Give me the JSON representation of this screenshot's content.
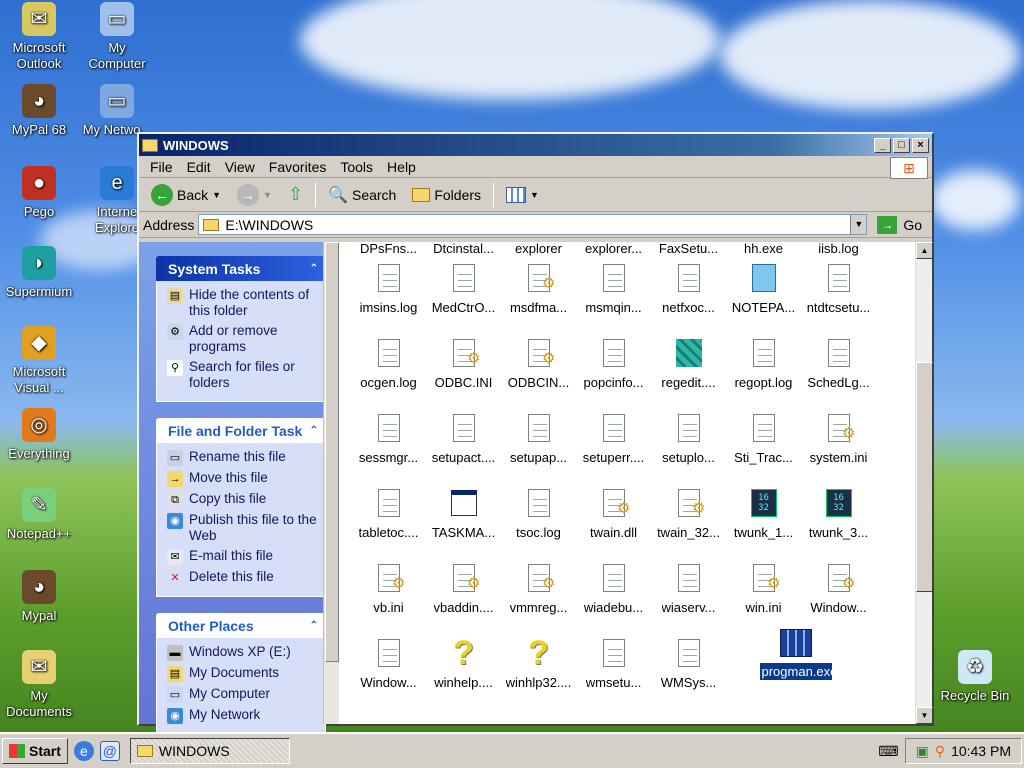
{
  "desktop": {
    "icons": [
      {
        "label": "Microsoft Outlook",
        "icon": "outlook-icon"
      },
      {
        "label": "My Computer",
        "icon": "computer-icon"
      },
      {
        "label": "MyPal 68",
        "icon": "mypal-icon"
      },
      {
        "label": "My Netwo...",
        "icon": "network-icon"
      },
      {
        "label": "Pego",
        "icon": "pego-icon"
      },
      {
        "label": "Interne Explore",
        "icon": "ie-icon"
      },
      {
        "label": "Supermium",
        "icon": "supermium-icon"
      },
      {
        "label": "Microsoft Visual ...",
        "icon": "visual-icon"
      },
      {
        "label": "Everything",
        "icon": "everything-icon"
      },
      {
        "label": "Notepad++",
        "icon": "notepadpp-icon"
      },
      {
        "label": "Mypal",
        "icon": "mypal-icon"
      },
      {
        "label": "My Documents",
        "icon": "documents-icon"
      },
      {
        "label": "Recycle Bin",
        "icon": "recycle-bin-icon"
      }
    ]
  },
  "window": {
    "title": "WINDOWS",
    "menu": [
      "File",
      "Edit",
      "View",
      "Favorites",
      "Tools",
      "Help"
    ],
    "toolbar": {
      "back": "Back",
      "search": "Search",
      "folders": "Folders"
    },
    "address": {
      "label": "Address",
      "value": "E:\\WINDOWS",
      "go": "Go"
    }
  },
  "tasks": {
    "system": {
      "title": "System Tasks",
      "items": [
        "Hide the contents of this folder",
        "Add or remove programs",
        "Search for files or folders"
      ]
    },
    "file_folder": {
      "title": "File and Folder Task",
      "items": [
        "Rename this file",
        "Move this file",
        "Copy this file",
        "Publish this file to the Web",
        "E-mail this file",
        "Delete this file"
      ]
    },
    "other": {
      "title": "Other Places",
      "items": [
        "Windows XP (E:)",
        "My Documents",
        "My Computer",
        "My Network"
      ]
    }
  },
  "files": {
    "top_partial": [
      "DPsFns...",
      "Dtcinstal...",
      "explorer",
      "explorer...",
      "FaxSetu...",
      "hh.exe",
      "iisb.log"
    ],
    "items": [
      {
        "name": "imsins.log",
        "type": "doc"
      },
      {
        "name": "MedCtrO...",
        "type": "doc"
      },
      {
        "name": "msdfma...",
        "type": "cfg"
      },
      {
        "name": "msmqin...",
        "type": "doc"
      },
      {
        "name": "netfxoc...",
        "type": "doc"
      },
      {
        "name": "NOTEPA...",
        "type": "note"
      },
      {
        "name": "ntdtcsetu...",
        "type": "doc"
      },
      {
        "name": "ocgen.log",
        "type": "doc"
      },
      {
        "name": "ODBC.INI",
        "type": "cfg"
      },
      {
        "name": "ODBCIN...",
        "type": "cfg"
      },
      {
        "name": "popcinfo...",
        "type": "doc"
      },
      {
        "name": "regedit....",
        "type": "cubes"
      },
      {
        "name": "regopt.log",
        "type": "doc"
      },
      {
        "name": "SchedLg...",
        "type": "doc"
      },
      {
        "name": "sessmgr...",
        "type": "doc"
      },
      {
        "name": "setupact....",
        "type": "doc"
      },
      {
        "name": "setupap...",
        "type": "doc"
      },
      {
        "name": "setuperr....",
        "type": "doc"
      },
      {
        "name": "setuplo...",
        "type": "doc"
      },
      {
        "name": "Sti_Trac...",
        "type": "doc"
      },
      {
        "name": "system.ini",
        "type": "cfg"
      },
      {
        "name": "tabletoc....",
        "type": "doc"
      },
      {
        "name": "TASKMA...",
        "type": "app"
      },
      {
        "name": "tsoc.log",
        "type": "doc"
      },
      {
        "name": "twain.dll",
        "type": "cfg"
      },
      {
        "name": "twain_32...",
        "type": "cfg"
      },
      {
        "name": "twunk_1...",
        "type": "blk"
      },
      {
        "name": "twunk_3...",
        "type": "blk"
      },
      {
        "name": "vb.ini",
        "type": "cfg"
      },
      {
        "name": "vbaddin....",
        "type": "cfg"
      },
      {
        "name": "vmmreg...",
        "type": "cfg"
      },
      {
        "name": "wiadebu...",
        "type": "doc"
      },
      {
        "name": "wiaserv...",
        "type": "doc"
      },
      {
        "name": "win.ini",
        "type": "cfg"
      },
      {
        "name": "Window...",
        "type": "cfg"
      },
      {
        "name": "Window...",
        "type": "doc"
      },
      {
        "name": "winhelp....",
        "type": "help"
      },
      {
        "name": "winhlp32....",
        "type": "help"
      },
      {
        "name": "wmsetu...",
        "type": "doc"
      },
      {
        "name": "WMSys...",
        "type": "doc"
      }
    ],
    "selected": {
      "name": "progman.exe"
    }
  },
  "blk_text": "16\n32",
  "taskbar": {
    "start": "Start",
    "task": "WINDOWS",
    "time": "10:43 PM"
  }
}
